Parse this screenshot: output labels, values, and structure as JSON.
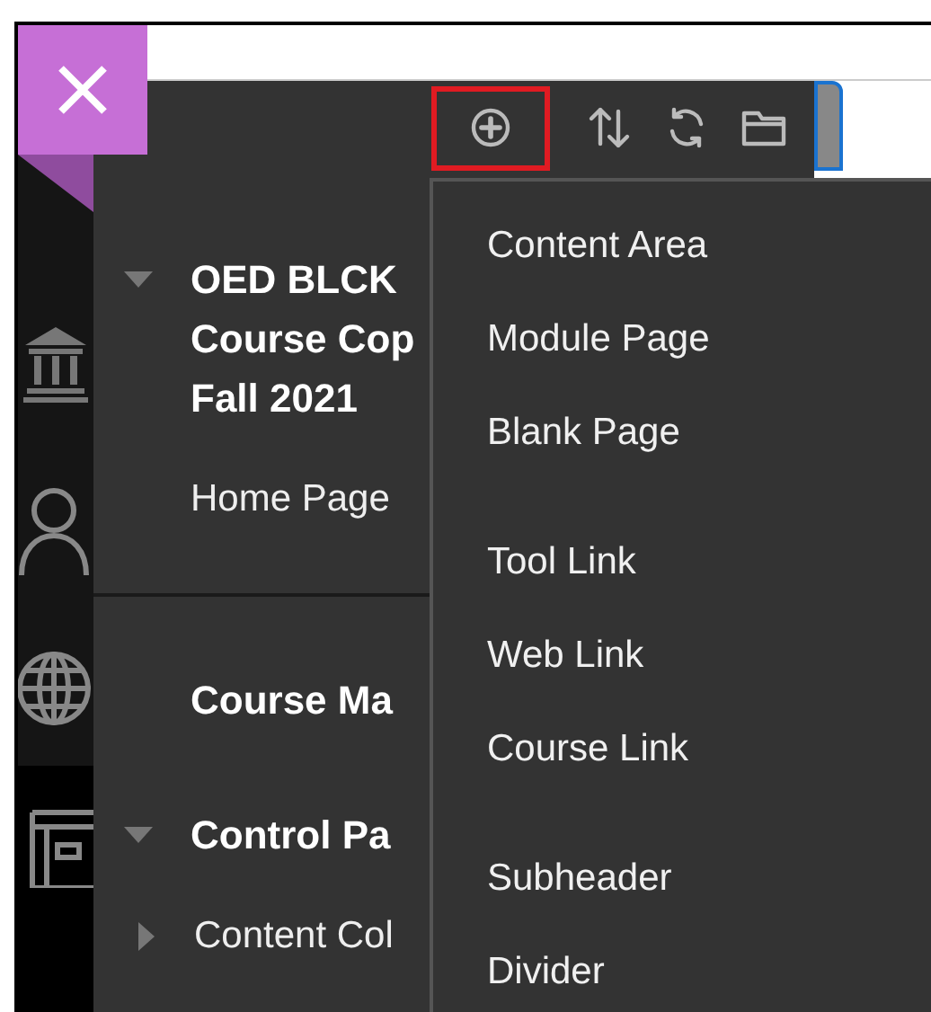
{
  "toolbar": {
    "buttons": [
      {
        "kind": "add",
        "highlighted": true
      },
      {
        "kind": "sort",
        "highlighted": false
      },
      {
        "kind": "refresh",
        "highlighted": false
      },
      {
        "kind": "folder",
        "highlighted": false
      }
    ]
  },
  "course": {
    "expanded": true,
    "title_lines": [
      "OED BLCK",
      "Course Cop",
      "Fall 2021"
    ]
  },
  "course_links": [
    "Home Page"
  ],
  "sections": [
    {
      "label": "Course Ma"
    },
    {
      "label": "Control Pa",
      "expanded": true,
      "children": [
        {
          "label": "Content Col",
          "expanded": false
        }
      ]
    }
  ],
  "menu": {
    "groups": [
      [
        "Content Area",
        "Module Page",
        "Blank Page"
      ],
      [
        "Tool Link",
        "Web Link",
        "Course Link"
      ],
      [
        "Subheader",
        "Divider"
      ]
    ]
  }
}
